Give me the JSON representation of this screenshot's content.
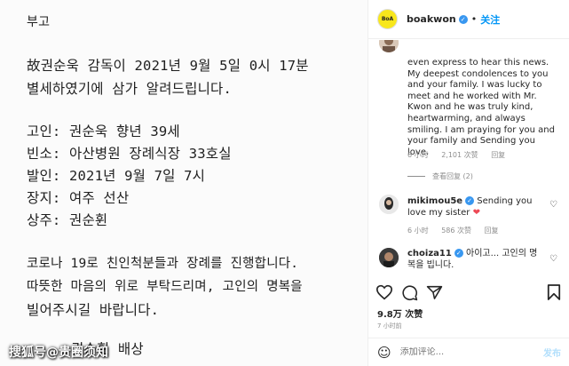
{
  "post": {
    "lines": [
      "부고",
      "故권순욱 감독이 2021년 9월 5일 0시 17분",
      "별세하였기에 삼가 알려드립니다.",
      "고인: 권순욱 향년 39세",
      "빈소: 아산병원 장례식장 33호실",
      "발인: 2021년 9월 7일 7시",
      "장지: 여주 선산",
      "상주: 권순휜",
      "코로나 19로 친인척분들과 장례를 진행합니다.",
      "따뜻한 마음의 위로 부탁드리며, 고인의 명복을",
      "빌어주시길 바랍니다.",
      "권순휜 배상"
    ],
    "watermark": "搜狐号@贵圈须知"
  },
  "header": {
    "logo_text": "BoA",
    "username": "boakwon",
    "separator": "•",
    "follow": "关注"
  },
  "comments": [
    {
      "text": "even express to hear this news. My deepest condolences to you and your family. I was lucky to meet and he worked with Mr. Kwon and he was truly kind, heartwarming, and always smiling. I am praying for you and your family and Sending you love.",
      "time": "6 小时",
      "likes": "2,101 次赞",
      "reply": "回复",
      "view_replies": "查看回复 (2)"
    },
    {
      "user": "mikimou5e",
      "text": "Sending you love my sister",
      "time": "6 小时",
      "likes": "586 次赞",
      "reply": "回复"
    },
    {
      "user": "choiza11",
      "text": "아이고... 고인의 명복을 빕니다.",
      "time": ""
    }
  ],
  "likes_count": "9.8万 次赞",
  "posted_time": "7 小时前",
  "composer": {
    "placeholder": "添加评论...",
    "post": "发布"
  },
  "colors": {
    "accent": "#0095f6",
    "heart_red": "#ed4956",
    "logo_yellow": "#f8e71c"
  }
}
